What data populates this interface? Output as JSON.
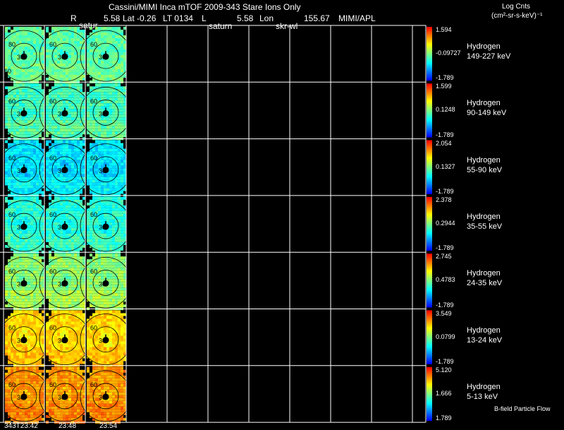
{
  "header": {
    "title": "Cassini/MIMI Inca mTOF  2009-343   Stare   Ions Only",
    "r_label": "R",
    "r_value": "5.58",
    "lat": "Lat -0.26",
    "lt": "LT 0134",
    "l_label": "L",
    "l_value": "5.58",
    "lon_label": "Lon",
    "lon_value": "155.67",
    "source": "MIMI/APL",
    "sub_labels": [
      "satur",
      "saturn",
      "skr-wl"
    ],
    "units_line1": "Log Cnts",
    "units_line2": "(cm²-sr-s-keV)⁻¹"
  },
  "footer": {
    "note": "B-field Particle Flow",
    "times": [
      "343T23:42",
      "23:48",
      "23:54"
    ]
  },
  "colors": {
    "background": "#000000",
    "grid_lines": "#ffffff",
    "cmap": [
      "#0000ff",
      "#0080ff",
      "#00ffff",
      "#80ff80",
      "#ffff00",
      "#ff8000",
      "#ff0000"
    ]
  },
  "chart_data": {
    "type": "heatmap",
    "description_rows": "energy channels",
    "columns": 3,
    "rows": [
      {
        "species": "Hydrogen",
        "energy": "149-227 keV",
        "cmax": "1.594",
        "cmid": "-0.09727",
        "cmin": "-1.789",
        "level": 0.45,
        "contours": [
          [
            "30",
            "80",
            "60"
          ],
          [
            "30",
            "60",
            ""
          ],
          [
            "30",
            "60",
            ""
          ]
        ]
      },
      {
        "species": "Hydrogen",
        "energy": "90-149 keV",
        "cmax": "1.599",
        "cmid": "0.1248",
        "cmin": "-1.789",
        "level": 0.42,
        "contours": [
          [
            "30",
            "60",
            ""
          ],
          [
            "30",
            "60",
            ""
          ],
          [
            "30",
            "60",
            ""
          ]
        ]
      },
      {
        "species": "Hydrogen",
        "energy": "55-90 keV",
        "cmax": "2.054",
        "cmid": "0.1327",
        "cmin": "-1.789",
        "level": 0.3,
        "contours": [
          [
            "30",
            "60",
            ""
          ],
          [
            "30",
            "60",
            ""
          ],
          [
            "30",
            "60",
            ""
          ]
        ]
      },
      {
        "species": "Hydrogen",
        "energy": "35-55 keV",
        "cmax": "2.378",
        "cmid": "0.2944",
        "cmin": "-1.789",
        "level": 0.38,
        "contours": [
          [
            "30",
            "60",
            ""
          ],
          [
            "30",
            "60",
            ""
          ],
          [
            "30",
            "60",
            ""
          ]
        ]
      },
      {
        "species": "Hydrogen",
        "energy": "24-35 keV",
        "cmax": "2.745",
        "cmid": "0.4783",
        "cmin": "-1.789",
        "level": 0.52,
        "contours": [
          [
            "30",
            "60",
            ""
          ],
          [
            "30",
            "60",
            ""
          ],
          [
            "30",
            "60",
            ""
          ]
        ]
      },
      {
        "species": "Hydrogen",
        "energy": "13-24 keV",
        "cmax": "3.549",
        "cmid": "0.0799",
        "cmin": "-1.789",
        "level": 0.72,
        "contours": [
          [
            "30",
            "60",
            ""
          ],
          [
            "30",
            "60",
            ""
          ],
          [
            "30",
            "60",
            ""
          ]
        ]
      },
      {
        "species": "Hydrogen",
        "energy": "5-13 keV",
        "cmax": "5.120",
        "cmid": "1.666",
        "cmin": "1.789",
        "level": 0.8,
        "contours": [
          [
            "30",
            "60",
            ""
          ],
          [
            "30",
            "60",
            ""
          ],
          [
            "30",
            "60",
            ""
          ]
        ]
      }
    ]
  }
}
